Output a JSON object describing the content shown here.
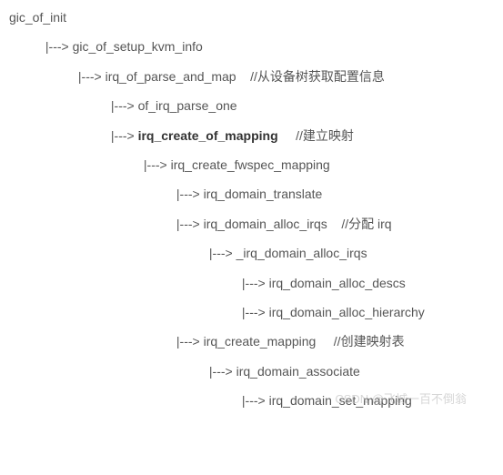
{
  "tree": {
    "root": "gic_of_init",
    "n1": "gic_of_setup_kvm_info",
    "n2": "irq_of_parse_and_map",
    "c2": "//从设备树获取配置信息",
    "n3": "of_irq_parse_one",
    "n4": "irq_create_of_mapping",
    "c4": "//建立映射",
    "n5": "irq_create_fwspec_mapping",
    "n6": "irq_domain_translate",
    "n7": "irq_domain_alloc_irqs",
    "c7": "//分配 irq",
    "n8": "_irq_domain_alloc_irqs",
    "n9": "irq_domain_alloc_descs",
    "n10": "irq_domain_alloc_hierarchy",
    "n11": "irq_create_mapping",
    "c11": "//创建映射表",
    "n12": "irq_domain_associate",
    "n13": "irq_domain_set_mapping",
    "watermark": "CSDN @飞城一百不倒翁"
  },
  "arrow": "|--->"
}
